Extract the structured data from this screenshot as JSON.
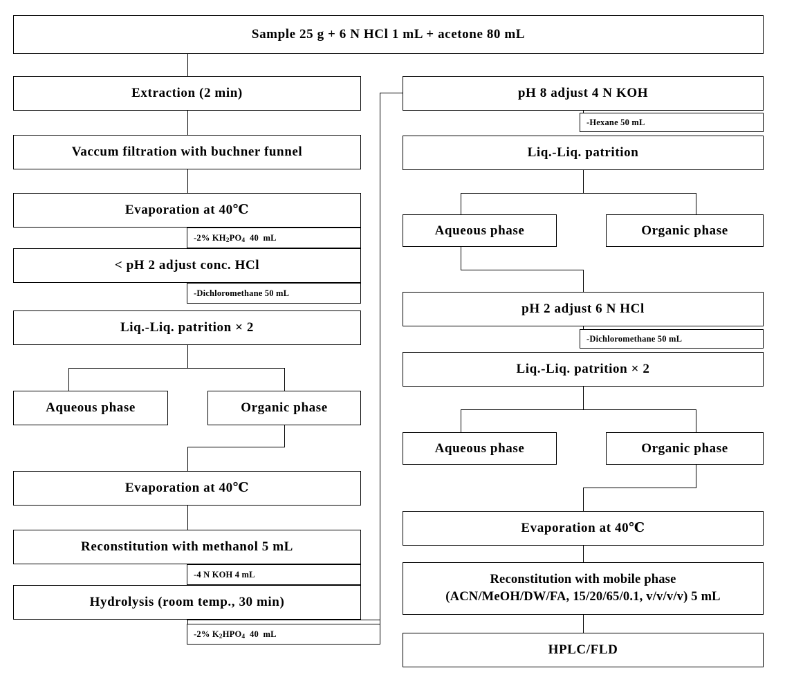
{
  "diagram": {
    "title": "Analytical sample preparation flowchart",
    "header": {
      "label": "Sample  25 g + 6 N  HCl 1 mL + acetone 80 mL"
    },
    "left_column": {
      "steps": [
        {
          "id": "extraction",
          "label": "Extraction  (2 min)"
        },
        {
          "id": "vacuum-filtration",
          "label": "Vaccum  filtration  with  buchner  funnel"
        },
        {
          "id": "evaporation-40-1",
          "label": "Evaporation  at  40℃"
        },
        {
          "id": "ph2-adjust-hcl",
          "label": "<  pH  2  adjust  conc.  HCl"
        },
        {
          "id": "liq-liq-partition-x2",
          "label": "Liq.-Liq.  patrition  ×  2"
        },
        {
          "id": "aqueous-phase-left",
          "label": "Aqueous  phase"
        },
        {
          "id": "organic-phase-left",
          "label": "Organic  phase"
        },
        {
          "id": "evaporation-40-2",
          "label": "Evaporation  at  40℃"
        },
        {
          "id": "reconstitution-methanol",
          "label": "Reconstitution  with  methanol  5  mL"
        },
        {
          "id": "hydrolysis",
          "label": "Hydrolysis  (room  temp.,  30  min)"
        }
      ],
      "reagents": [
        {
          "id": "kh2po4",
          "label": "-2% KH2PO4  40  mL"
        },
        {
          "id": "dichloromethane-left",
          "label": "-Dichloromethane  50  mL"
        },
        {
          "id": "koh-4n",
          "label": "-4 N  KOH 4  mL"
        },
        {
          "id": "k2hpo4",
          "label": "-2% K2HPO4  40  mL"
        }
      ]
    },
    "right_column": {
      "steps": [
        {
          "id": "ph8-adjust-koh",
          "label": "pH  8  adjust  4  N  KOH"
        },
        {
          "id": "liq-liq-partition",
          "label": "Liq.-Liq.  patrition"
        },
        {
          "id": "aqueous-phase-right-1",
          "label": "Aqueous  phase"
        },
        {
          "id": "organic-phase-right-1",
          "label": "Organic  phase"
        },
        {
          "id": "ph2-adjust-6n-hcl",
          "label": "pH  2  adjust  6  N  HCl"
        },
        {
          "id": "liq-liq-partition-x2-right",
          "label": "Liq.-Liq.  patrition  ×  2"
        },
        {
          "id": "aqueous-phase-right-2",
          "label": "Aqueous  phase"
        },
        {
          "id": "organic-phase-right-2",
          "label": "Organic  phase"
        },
        {
          "id": "evaporation-40-3",
          "label": "Evaporation  at  40℃"
        },
        {
          "id": "reconstitution-mobile-phase-line1",
          "label": "Reconstitution  with  mobile  phase"
        },
        {
          "id": "reconstitution-mobile-phase-line2",
          "label": "(ACN/MeOH/DW/FA, 15/20/65/0.1, v/v/v/v)  5  mL"
        },
        {
          "id": "hplc-fld",
          "label": "HPLC/FLD"
        }
      ],
      "reagents": [
        {
          "id": "hexane",
          "label": "-Hexane 50 mL"
        },
        {
          "id": "dichloromethane-right",
          "label": "-Dichloromethane 50 mL"
        }
      ]
    },
    "colors": {
      "stroke": "#000000",
      "background": "#ffffff",
      "text": "#000000"
    }
  }
}
